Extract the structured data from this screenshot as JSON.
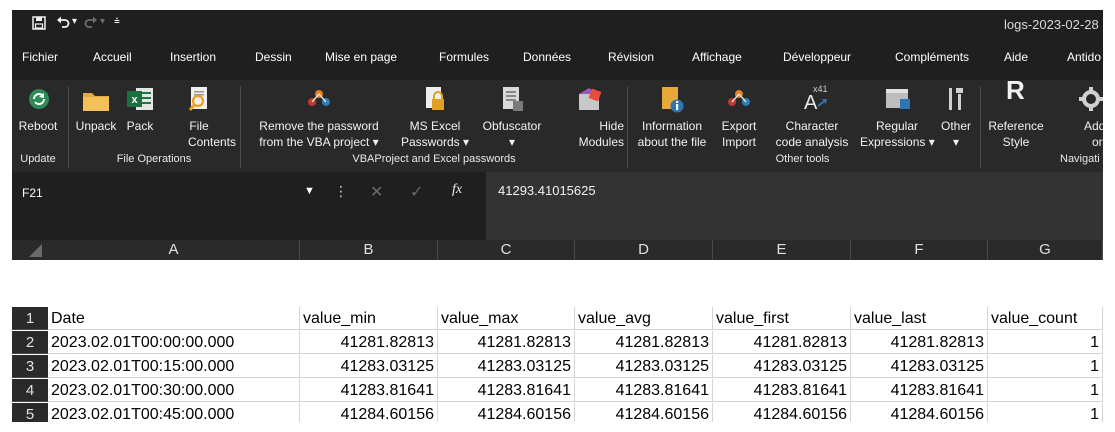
{
  "titlebar": {
    "doc_title": "logs-2023-02-28"
  },
  "tabs": [
    {
      "label": "Fichier"
    },
    {
      "label": "Accueil"
    },
    {
      "label": "Insertion"
    },
    {
      "label": "Dessin"
    },
    {
      "label": "Mise en page"
    },
    {
      "label": "Formules"
    },
    {
      "label": "Données"
    },
    {
      "label": "Révision"
    },
    {
      "label": "Affichage"
    },
    {
      "label": "Développeur"
    },
    {
      "label": "Compléments"
    },
    {
      "label": "Aide"
    },
    {
      "label": "Antido"
    }
  ],
  "ribbon": {
    "reboot": {
      "line1": "Reboot",
      "group": "Update"
    },
    "unpack": {
      "line1": "Unpack"
    },
    "pack": {
      "line1": "Pack"
    },
    "file_contents": {
      "line1": "File",
      "line2": "Contents"
    },
    "file_ops_group": "File Operations",
    "remove_pw": {
      "line1": "Remove the password",
      "line2": "from the VBA project ▾"
    },
    "ms_excel_pw": {
      "line1": "MS Excel",
      "line2": "Passwords ▾"
    },
    "obfuscator": {
      "line1": "Obfuscator",
      "line2": "▾"
    },
    "hide_modules": {
      "line1": "Hide",
      "line2": "Modules"
    },
    "vba_group": "VBAProject and Excel passwords",
    "information": {
      "line1": "Information",
      "line2": "about the file"
    },
    "export_import": {
      "line1": "Export",
      "line2": "Import"
    },
    "char_analysis": {
      "line1": "Character",
      "line2": "code analysis",
      "badge": "x41"
    },
    "regex": {
      "line1": "Regular",
      "line2": "Expressions ▾"
    },
    "other": {
      "line1": "Other",
      "line2": "▾"
    },
    "other_tools_group": "Other tools",
    "reference_style": {
      "line1": "Reference",
      "line2": "Style",
      "glyph": "R"
    },
    "add_on": {
      "line1": "Add",
      "line2": "on"
    },
    "navigation_group": "Navigati"
  },
  "formula_bar": {
    "name_box": "F21",
    "fx": "fx",
    "value": "41293.41015625"
  },
  "sheet": {
    "columns": [
      "A",
      "B",
      "C",
      "D",
      "E",
      "F",
      "G"
    ],
    "rows": [
      {
        "n": "1",
        "cells": [
          "Date",
          "value_min",
          "value_max",
          "value_avg",
          "value_first",
          "value_last",
          "value_count"
        ]
      },
      {
        "n": "2",
        "cells": [
          "2023.02.01T00:00:00.000",
          "41281.82813",
          "41281.82813",
          "41281.82813",
          "41281.82813",
          "41281.82813",
          "1"
        ]
      },
      {
        "n": "3",
        "cells": [
          "2023.02.01T00:15:00.000",
          "41283.03125",
          "41283.03125",
          "41283.03125",
          "41283.03125",
          "41283.03125",
          "1"
        ]
      },
      {
        "n": "4",
        "cells": [
          "2023.02.01T00:30:00.000",
          "41283.81641",
          "41283.81641",
          "41283.81641",
          "41283.81641",
          "41283.81641",
          "1"
        ]
      },
      {
        "n": "5",
        "cells": [
          "2023.02.01T00:45:00.000",
          "41284.60156",
          "41284.60156",
          "41284.60156",
          "41284.60156",
          "41284.60156",
          "1"
        ]
      }
    ]
  }
}
